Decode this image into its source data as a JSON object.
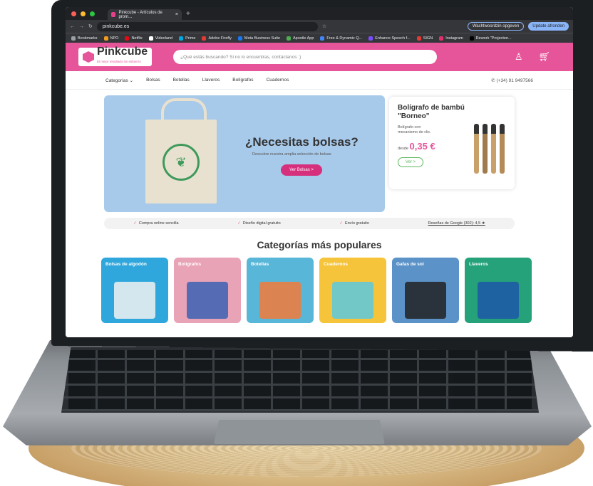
{
  "browser": {
    "tab_title": "Pinkcube - Artículos de prom...",
    "url": "pinkcube.es",
    "password_button": "Wachtwoordzin opgeven",
    "update_button": "Update afronden",
    "bookmarks": [
      "Bookmarks",
      "NPO",
      "Netflix",
      "Videoland",
      "Prime",
      "Adobe Firefly",
      "Meta Business Suite",
      "Apostle App",
      "Free & Dynamic Q...",
      "Enhance Speech f...",
      "SIGN",
      "Instagram",
      "Rework \"Projecten..."
    ]
  },
  "site": {
    "brand": "Pinkcube",
    "tagline": "El mejor resultado sin esfuerzo",
    "search_placeholder": "¿Qué estás buscando? Si no lo encuentras, contáctanos :)",
    "nav": [
      "Categorías ⌄",
      "Bolsas",
      "Botellas",
      "Llaveros",
      "Bolígrafos",
      "Cuadernos"
    ],
    "phone": "(+34) 91 9497566",
    "hero": {
      "title": "¿Necesitas bolsas?",
      "subtitle": "Descubre nuestra amplia selección de bolsas",
      "button": "Ver Bolsas >"
    },
    "promo": {
      "title": "Bolígrafo de bambú \"Borneo\"",
      "desc": "Bolígrafo con mecanismo de clic.",
      "price_prefix": "desde",
      "price": "0,35 €",
      "button": "Ver >"
    },
    "trust": [
      "Compra online sencilla",
      "Diseño digital gratuito",
      "Envío gratuito",
      "Reseñas de Google (302): 4,5 ★"
    ],
    "categories_title": "Categorías más populares",
    "categories": [
      {
        "label": "Bolsas de algodón",
        "color": "#2fa7dc"
      },
      {
        "label": "Bolígrafos",
        "color": "#e9a3b7"
      },
      {
        "label": "Botellas",
        "color": "#58b6d8"
      },
      {
        "label": "Cuadernos",
        "color": "#f6c43b"
      },
      {
        "label": "Gafas de sol",
        "color": "#5b93c8"
      },
      {
        "label": "Llaveros",
        "color": "#25a27a"
      }
    ]
  }
}
